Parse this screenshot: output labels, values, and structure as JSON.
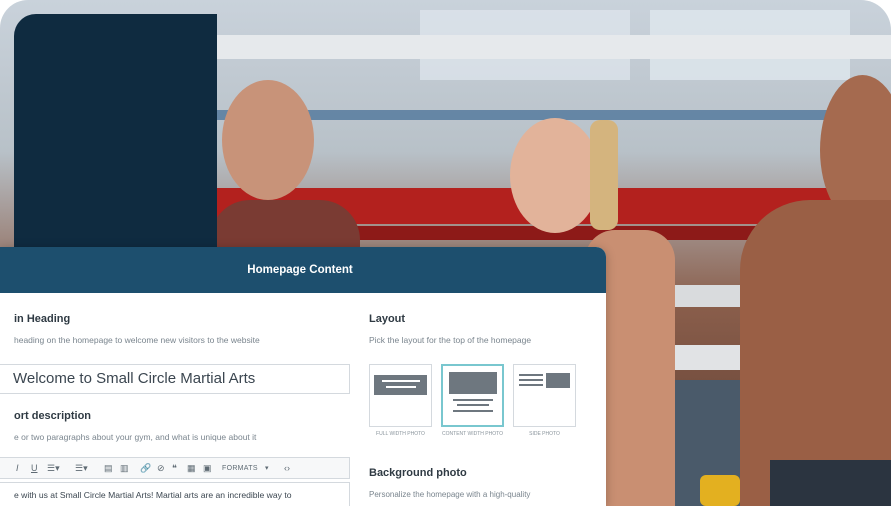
{
  "card": {
    "title": "Homepage Content"
  },
  "main_heading": {
    "title": "in Heading",
    "description": "heading on the homepage to welcome new visitors to the website",
    "value": "Welcome to Small Circle Martial Arts"
  },
  "short_description": {
    "title": "ort description",
    "description": "e or two paragraphs about your gym, and what is unique about it",
    "toolbar": {
      "italic": "I",
      "underline": "U",
      "formats": "FORMATS",
      "code": "‹›"
    },
    "text": "e with us at Small Circle Martial Arts! Martial arts are an incredible way to"
  },
  "layout": {
    "title": "Layout",
    "description": "Pick the layout for the top of the homepage",
    "options": [
      {
        "label": "FULL WIDTH PHOTO",
        "selected": false
      },
      {
        "label": "CONTENT WIDTH PHOTO",
        "selected": true
      },
      {
        "label": "SIDE PHOTO",
        "selected": false
      }
    ]
  },
  "background_photo": {
    "title": "Background photo",
    "description": "Personalize the homepage with a high-quality"
  },
  "colors": {
    "navy_panel": "#0f2b40",
    "card_header": "#1d4f6e",
    "selected_border": "#79c7cf"
  }
}
